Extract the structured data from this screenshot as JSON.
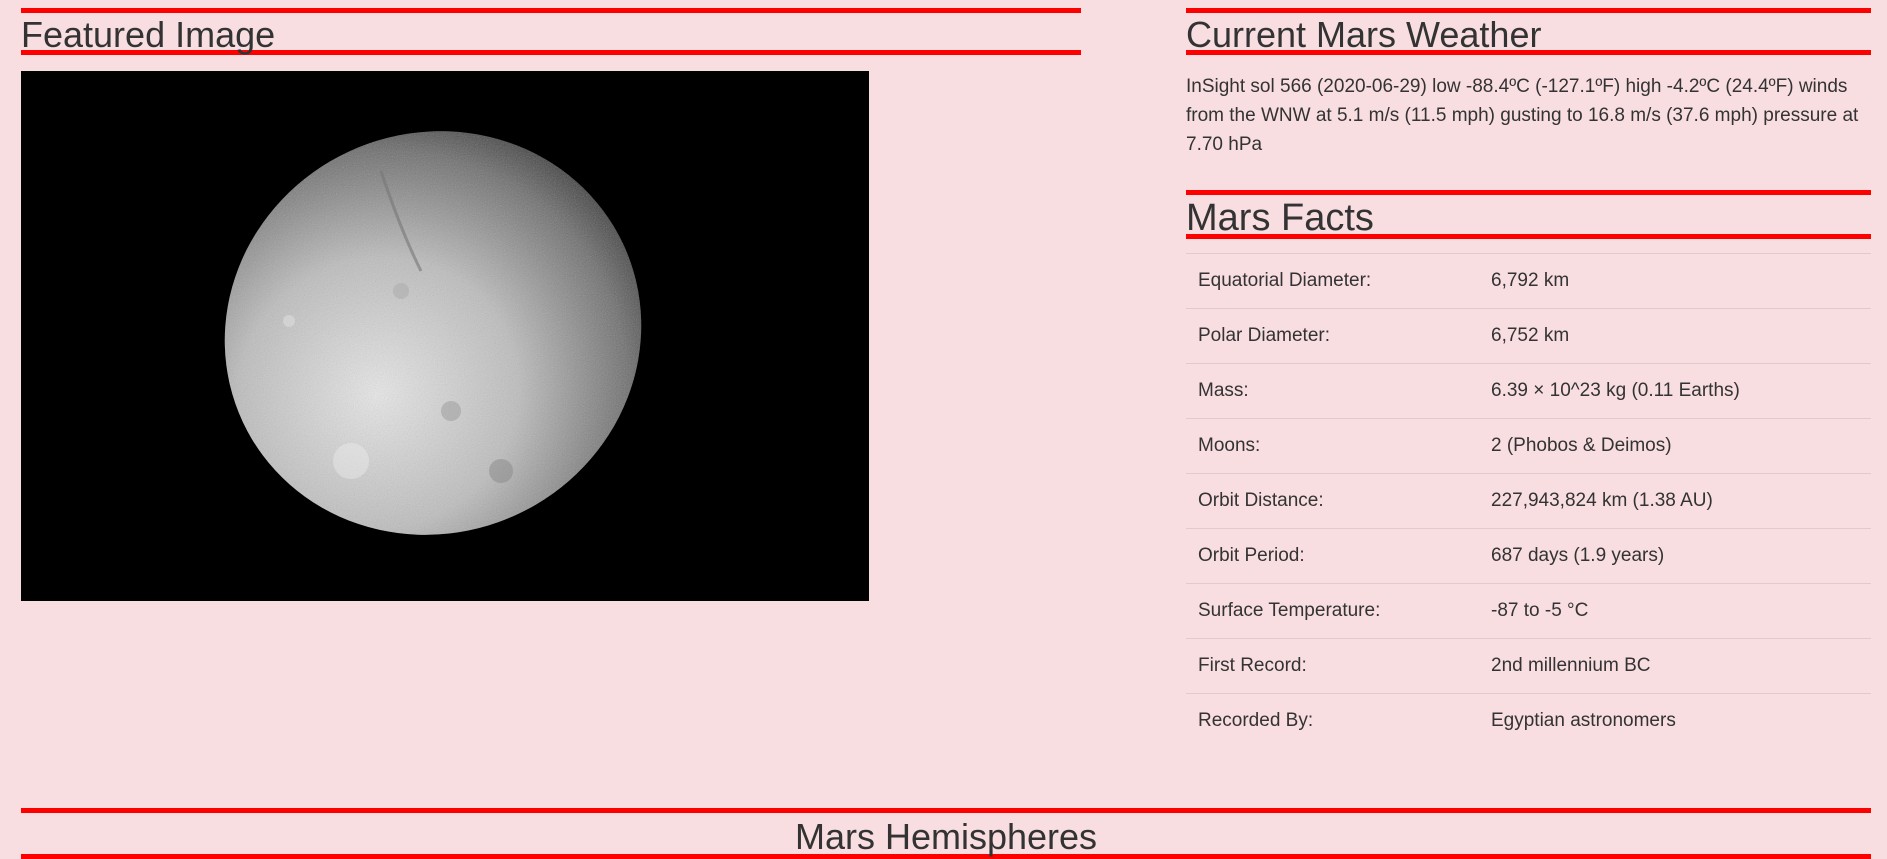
{
  "featured": {
    "heading": "Featured Image"
  },
  "weather": {
    "heading": "Current Mars Weather",
    "text": "InSight sol 566 (2020-06-29) low -88.4ºC (-127.1ºF) high -4.2ºC (24.4ºF) winds from the WNW at 5.1 m/s (11.5 mph) gusting to 16.8 m/s (37.6 mph) pressure at 7.70 hPa"
  },
  "facts": {
    "heading": "Mars Facts",
    "rows": [
      {
        "label": "Equatorial Diameter:",
        "value": "6,792 km"
      },
      {
        "label": "Polar Diameter:",
        "value": "6,752 km"
      },
      {
        "label": "Mass:",
        "value": "6.39 × 10^23 kg (0.11 Earths)"
      },
      {
        "label": "Moons:",
        "value": "2 (Phobos & Deimos)"
      },
      {
        "label": "Orbit Distance:",
        "value": "227,943,824 km (1.38 AU)"
      },
      {
        "label": "Orbit Period:",
        "value": "687 days (1.9 years)"
      },
      {
        "label": "Surface Temperature:",
        "value": "-87 to -5 °C"
      },
      {
        "label": "First Record:",
        "value": "2nd millennium BC"
      },
      {
        "label": "Recorded By:",
        "value": "Egyptian astronomers"
      }
    ]
  },
  "hemispheres": {
    "heading": "Mars Hemispheres"
  },
  "colors": {
    "background": "#f8dde1",
    "rule": "#ff0000",
    "text": "#333333"
  }
}
